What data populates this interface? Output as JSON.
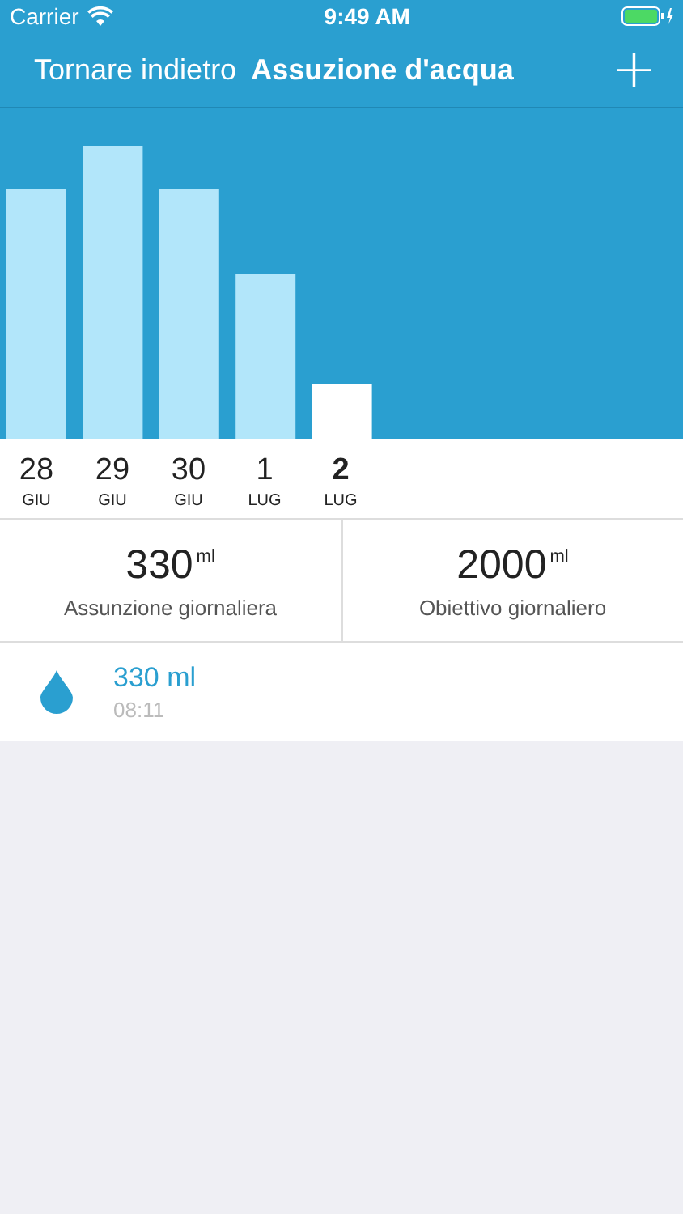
{
  "status_bar": {
    "carrier": "Carrier",
    "time": "9:49 AM"
  },
  "nav": {
    "back": "Tornare indietro",
    "title": "Assuzione d'acqua",
    "add": "+"
  },
  "days": [
    {
      "day": "28",
      "month": "GIU",
      "selected": false
    },
    {
      "day": "29",
      "month": "GIU",
      "selected": false
    },
    {
      "day": "30",
      "month": "GIU",
      "selected": false
    },
    {
      "day": "1",
      "month": "LUG",
      "selected": false
    },
    {
      "day": "2",
      "month": "LUG",
      "selected": true
    }
  ],
  "stats": [
    {
      "value": "330",
      "unit": "ml",
      "label": "Assunzione giornaliera"
    },
    {
      "value": "2000",
      "unit": "ml",
      "label": "Obiettivo giornaliero"
    }
  ],
  "entries": [
    {
      "amount": "330 ml",
      "time": "08:11"
    }
  ]
}
